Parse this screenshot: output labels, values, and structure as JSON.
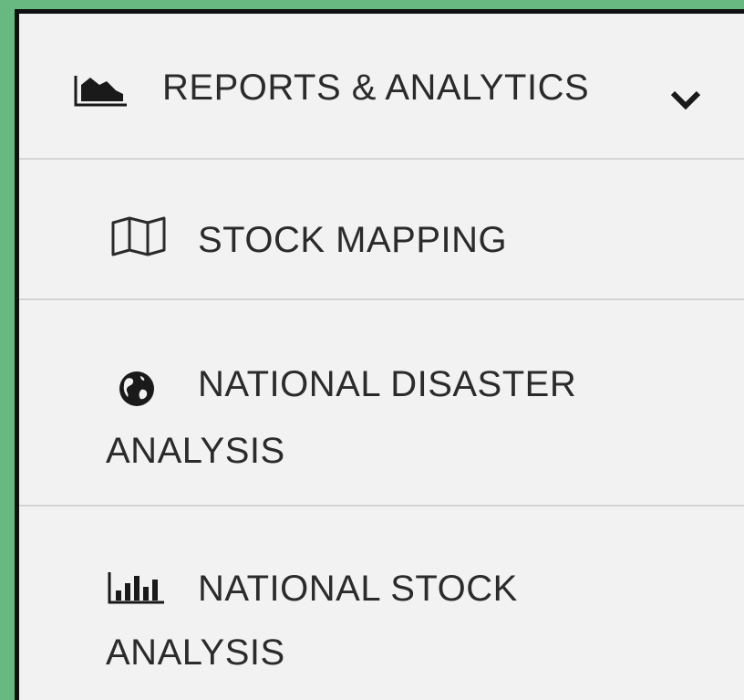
{
  "menu": {
    "header": {
      "icon": "area-chart-icon",
      "label": "REPORTS & ANALYTICS",
      "toggle_icon": "chevron-down-icon"
    },
    "items": [
      {
        "icon": "map-icon",
        "label": "STOCK MAPPING"
      },
      {
        "icon": "globe-icon",
        "label_line1": "NATIONAL DISASTER",
        "label_line2": "ANALYSIS"
      },
      {
        "icon": "bar-chart-icon",
        "label_line1": "NATIONAL STOCK",
        "label_line2": "ANALYSIS"
      }
    ]
  },
  "colors": {
    "background": "#67b881",
    "panel": "#f2f2f2",
    "divider": "#d4d4d4",
    "text": "#2b2b2b",
    "border": "#111111"
  }
}
